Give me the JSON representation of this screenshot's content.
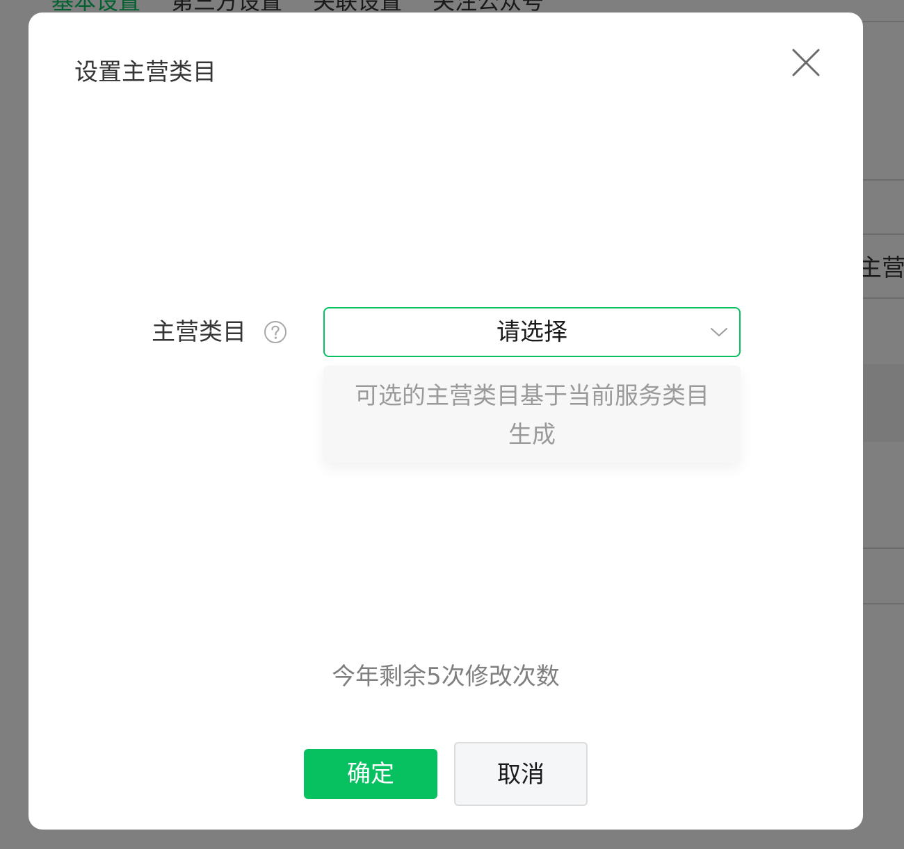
{
  "background": {
    "tabs": [
      {
        "label": "基本设置",
        "active": true
      },
      {
        "label": "第三方设置",
        "active": false
      },
      {
        "label": "关联设置",
        "active": false
      },
      {
        "label": "关注公众号",
        "active": false
      }
    ],
    "partial_label": "主营类"
  },
  "dialog": {
    "title": "设置主营类目",
    "close_icon": "close-icon",
    "field": {
      "label": "主营类目",
      "help_icon": "question-circle-icon",
      "select_placeholder": "请选择",
      "chevron_icon": "chevron-down-icon"
    },
    "tooltip": "可选的主营类目基于当前服务类目生成",
    "remaining_text": "今年剩余5次修改次数",
    "buttons": {
      "confirm": "确定",
      "cancel": "取消"
    }
  },
  "colors": {
    "accent": "#07c160",
    "overlay": "rgba(0,0,0,0.5)"
  }
}
